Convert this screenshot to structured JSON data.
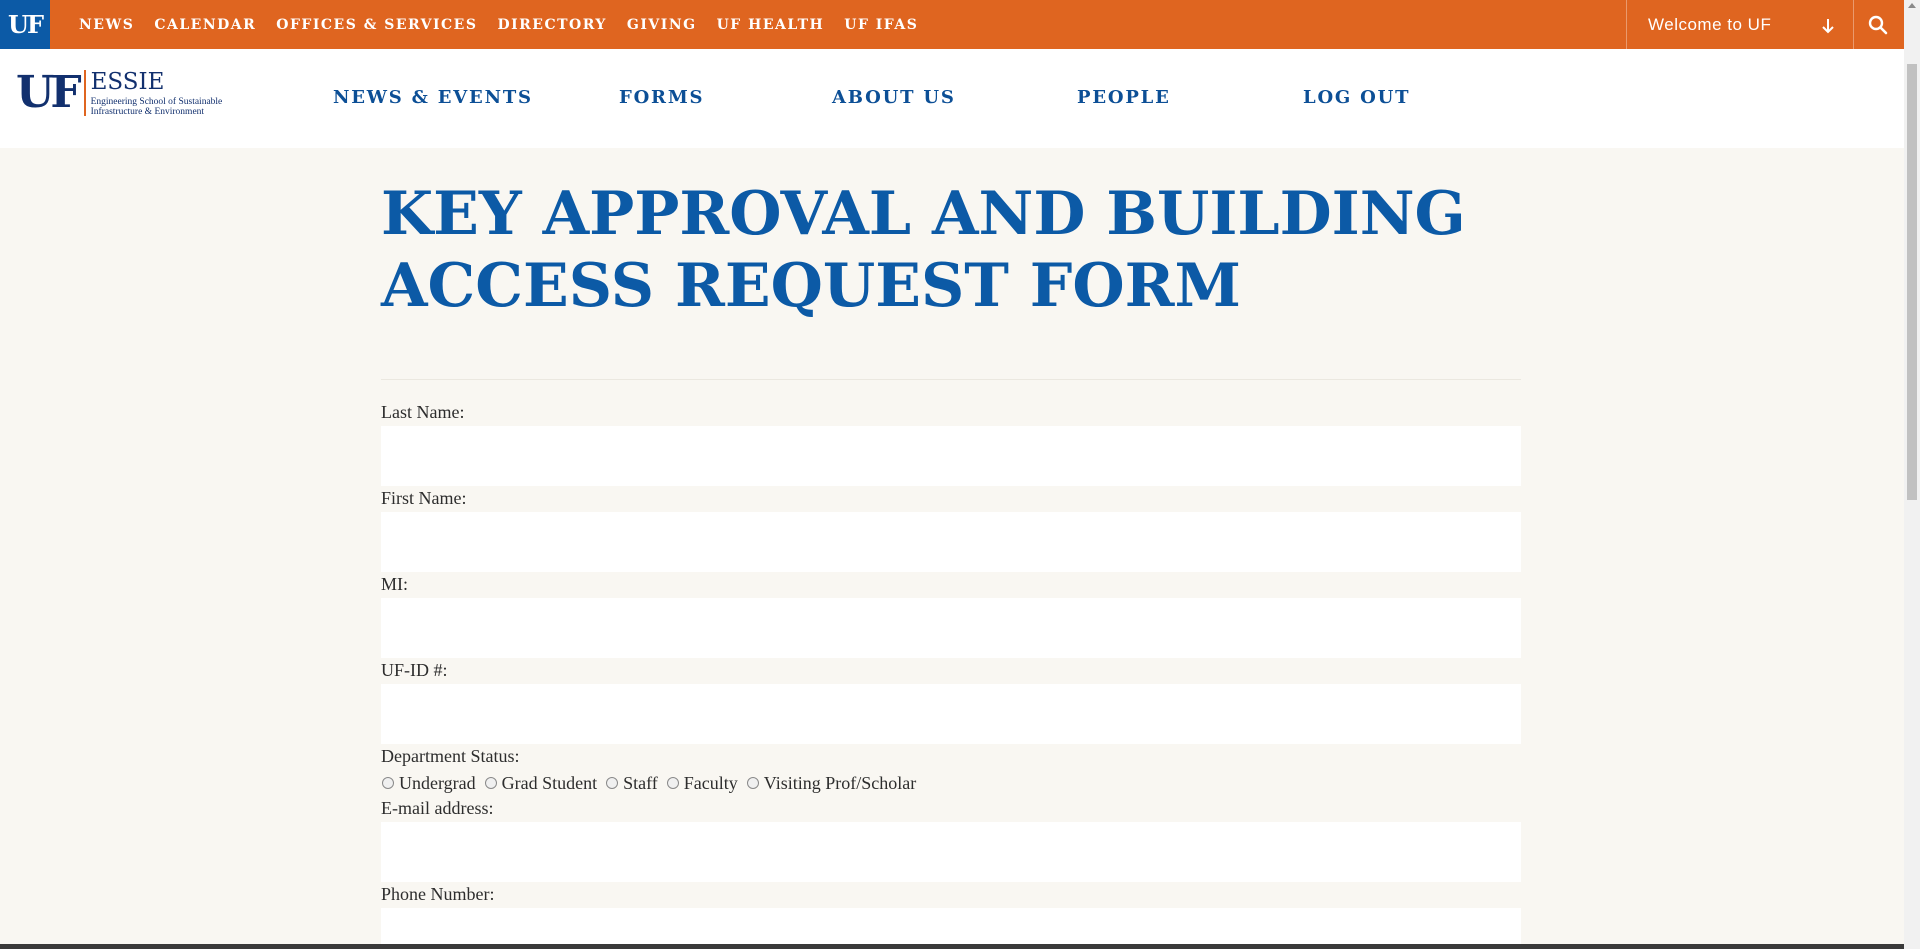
{
  "topbar": {
    "badge": "UF",
    "links": [
      "NEWS",
      "CALENDAR",
      "OFFICES & SERVICES",
      "DIRECTORY",
      "GIVING",
      "UF HEALTH",
      "UF IFAS"
    ],
    "welcome": "Welcome to UF",
    "arrow_icon": "arrow-down-icon",
    "search_icon": "search-icon"
  },
  "colors": {
    "orange": "#df6520",
    "uf_blue": "#0c5aa6",
    "nav_blue": "#0c4f96",
    "page_bg": "#f9f7f2"
  },
  "logo": {
    "mark": "UF",
    "name": "ESSIE",
    "sub_line1": "Engineering School of Sustainable",
    "sub_line2": "Infrastructure & Environment"
  },
  "mainnav": [
    "NEWS & EVENTS",
    "FORMS",
    "ABOUT US",
    "PEOPLE",
    "LOG OUT"
  ],
  "page": {
    "title_line1": "KEY APPROVAL AND BUILDING",
    "title_line2": "ACCESS REQUEST FORM"
  },
  "form": {
    "last_name": {
      "label": "Last Name:",
      "value": ""
    },
    "first_name": {
      "label": "First Name:",
      "value": ""
    },
    "mi": {
      "label": "MI:",
      "value": ""
    },
    "ufid": {
      "label": "UF-ID #:",
      "value": ""
    },
    "dept_status": {
      "label": "Department Status:",
      "options": [
        "Undergrad",
        "Grad Student",
        "Staff",
        "Faculty",
        "Visiting Prof/Scholar"
      ],
      "selected": null
    },
    "email": {
      "label": "E-mail address:",
      "value": ""
    },
    "phone": {
      "label": "Phone Number:",
      "value": ""
    }
  }
}
